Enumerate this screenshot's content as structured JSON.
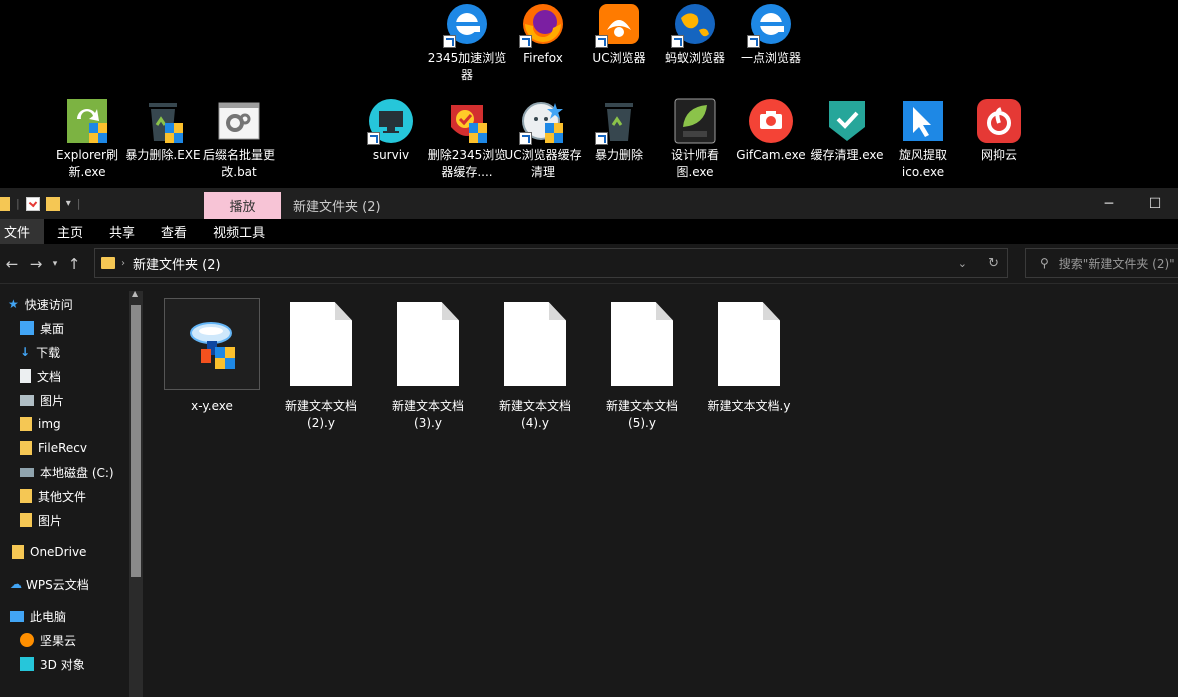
{
  "desktop": {
    "icons_row1": [
      {
        "label": "2345加速浏览器",
        "icon": "ie-browser-icon"
      },
      {
        "label": "Firefox",
        "icon": "firefox-icon"
      },
      {
        "label": "UC浏览器",
        "icon": "uc-browser-icon"
      },
      {
        "label": "蚂蚁浏览器",
        "icon": "globe-icon"
      },
      {
        "label": "一点浏览器",
        "icon": "ie-browser-icon"
      }
    ],
    "icons_row2": [
      {
        "label": "Explorer刷新.exe",
        "icon": "refresh-shield-icon"
      },
      {
        "label": "暴力删除.EXE",
        "icon": "trash-shield-icon"
      },
      {
        "label": "后缀名批量更改.bat",
        "icon": "gear-batch-icon"
      },
      {
        "label": "surviv",
        "icon": "monitor-icon"
      },
      {
        "label": "删除2345浏览器缓存....",
        "icon": "clean-shield-icon"
      },
      {
        "label": "UC浏览器缓存清理",
        "icon": "clean-uc-icon"
      },
      {
        "label": "暴力删除",
        "icon": "trash-icon"
      },
      {
        "label": "设计师看图.exe",
        "icon": "png-viewer-icon"
      },
      {
        "label": "GifCam.exe",
        "icon": "camera-icon"
      },
      {
        "label": "缓存清理.exe",
        "icon": "shield-check-icon"
      },
      {
        "label": "旋风提取ico.exe",
        "icon": "cursor-icon"
      },
      {
        "label": "网抑云",
        "icon": "music-icon"
      }
    ]
  },
  "window": {
    "context_tab": "播放",
    "title": "新建文件夹 (2)"
  },
  "ribbon": {
    "tabs": [
      "文件",
      "主页",
      "共享",
      "查看",
      "视频工具"
    ]
  },
  "address": {
    "path": "新建文件夹 (2)",
    "search_placeholder": "搜索\"新建文件夹 (2)\""
  },
  "nav": {
    "quick_access": "快速访问",
    "items": [
      {
        "label": "桌面",
        "pinned": true
      },
      {
        "label": "下载",
        "pinned": true
      },
      {
        "label": "文档",
        "pinned": true
      },
      {
        "label": "图片",
        "pinned": true
      },
      {
        "label": "img",
        "pinned": true
      },
      {
        "label": "FileRecv",
        "pinned": false
      },
      {
        "label": "本地磁盘 (C:)",
        "pinned": true
      },
      {
        "label": "其他文件",
        "pinned": false
      },
      {
        "label": "图片",
        "pinned": false
      }
    ],
    "onedrive": "OneDrive",
    "wps": "WPS云文档",
    "this_pc": "此电脑",
    "pc_items": [
      "坚果云",
      "3D 对象"
    ]
  },
  "files": [
    {
      "name": "x-y.exe",
      "type": "exe"
    },
    {
      "name": "新建文本文档 (2).y",
      "type": "doc"
    },
    {
      "name": "新建文本文档 (3).y",
      "type": "doc"
    },
    {
      "name": "新建文本文档 (4).y",
      "type": "doc"
    },
    {
      "name": "新建文本文档 (5).y",
      "type": "doc"
    },
    {
      "name": "新建文本文档.y",
      "type": "doc"
    }
  ],
  "colors": {
    "folder": "#f5c754",
    "context_tab_bg": "#f7c4d6",
    "selection": "#333333"
  }
}
